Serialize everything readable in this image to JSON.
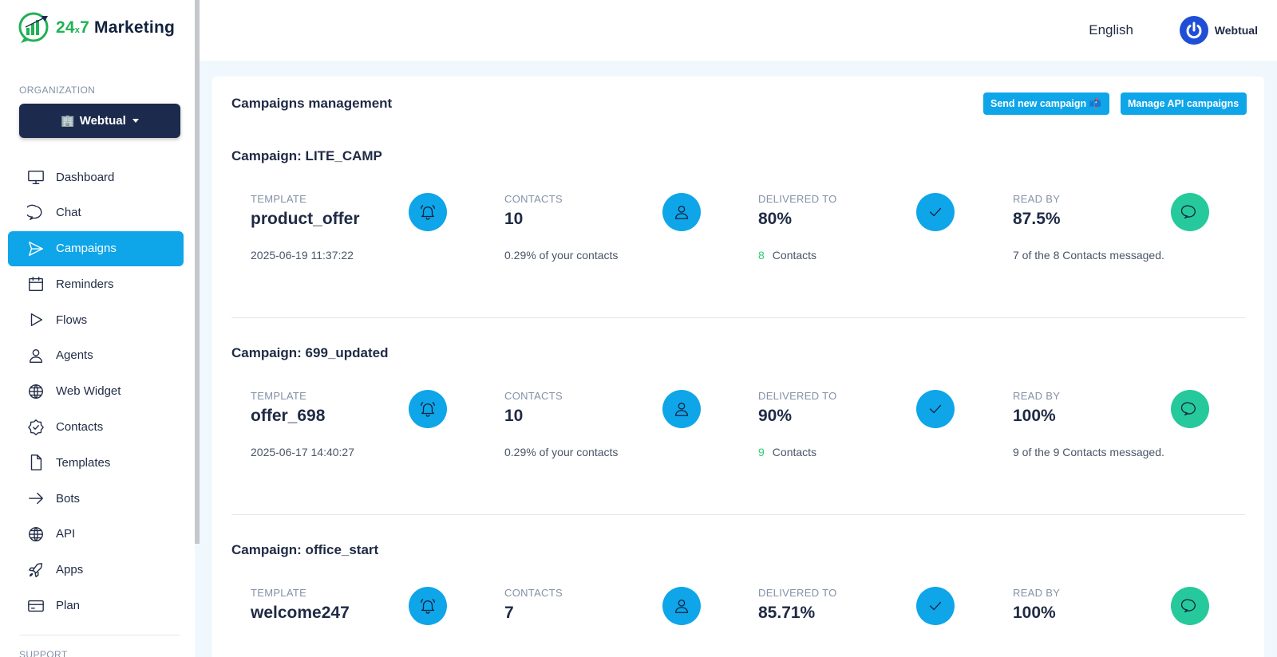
{
  "brand": {
    "num": "24",
    "x": "x",
    "num2": "7",
    "name": "Marketing"
  },
  "sidebar": {
    "org_label": "ORGANIZATION",
    "org_icon": "🏢",
    "org_name": "Webtual",
    "items": [
      {
        "label": "Dashboard",
        "icon": "monitor-icon"
      },
      {
        "label": "Chat",
        "icon": "chat-bubble-icon"
      },
      {
        "label": "Campaigns",
        "icon": "send-icon",
        "active": true
      },
      {
        "label": "Reminders",
        "icon": "calendar-icon"
      },
      {
        "label": "Flows",
        "icon": "play-icon"
      },
      {
        "label": "Agents",
        "icon": "user-icon"
      },
      {
        "label": "Web Widget",
        "icon": "globe-icon"
      },
      {
        "label": "Contacts",
        "icon": "badge-check-icon"
      },
      {
        "label": "Templates",
        "icon": "file-icon"
      },
      {
        "label": "Bots",
        "icon": "arrow-right-icon"
      },
      {
        "label": "API",
        "icon": "globe-icon"
      },
      {
        "label": "Apps",
        "icon": "rocket-icon"
      },
      {
        "label": "Plan",
        "icon": "credit-card-icon"
      }
    ],
    "support_label": "SUPPORT"
  },
  "topbar": {
    "language": "English",
    "user_name": "Webtual"
  },
  "main": {
    "title": "Campaigns management",
    "send_button": "Send new campaign 📫",
    "api_button": "Manage API campaigns",
    "labels": {
      "template": "TEMPLATE",
      "contacts": "CONTACTS",
      "delivered": "DELIVERED TO",
      "read": "READ BY",
      "contacts_word": "Contacts"
    },
    "campaigns": [
      {
        "title": "Campaign: LITE_CAMP",
        "template": "product_offer",
        "date": "2025-06-19 11:37:22",
        "contacts": "10",
        "contacts_sub": "0.29% of your contacts",
        "delivered": "80%",
        "delivered_count": "8",
        "read": "87.5%",
        "read_sub": "7 of the 8 Contacts messaged."
      },
      {
        "title": "Campaign: 699_updated",
        "template": "offer_698",
        "date": "2025-06-17 14:40:27",
        "contacts": "10",
        "contacts_sub": "0.29% of your contacts",
        "delivered": "90%",
        "delivered_count": "9",
        "read": "100%",
        "read_sub": "9 of the 9 Contacts messaged."
      },
      {
        "title": "Campaign: office_start",
        "template": "welcome247",
        "date": "",
        "contacts": "7",
        "contacts_sub": "",
        "delivered": "85.71%",
        "delivered_count": "",
        "read": "100%",
        "read_sub": ""
      }
    ]
  },
  "colors": {
    "accent": "#0ea5e9",
    "read_icon": "#26c99b",
    "brand_green": "#1fb254",
    "org_bg": "#1c2b4d"
  }
}
